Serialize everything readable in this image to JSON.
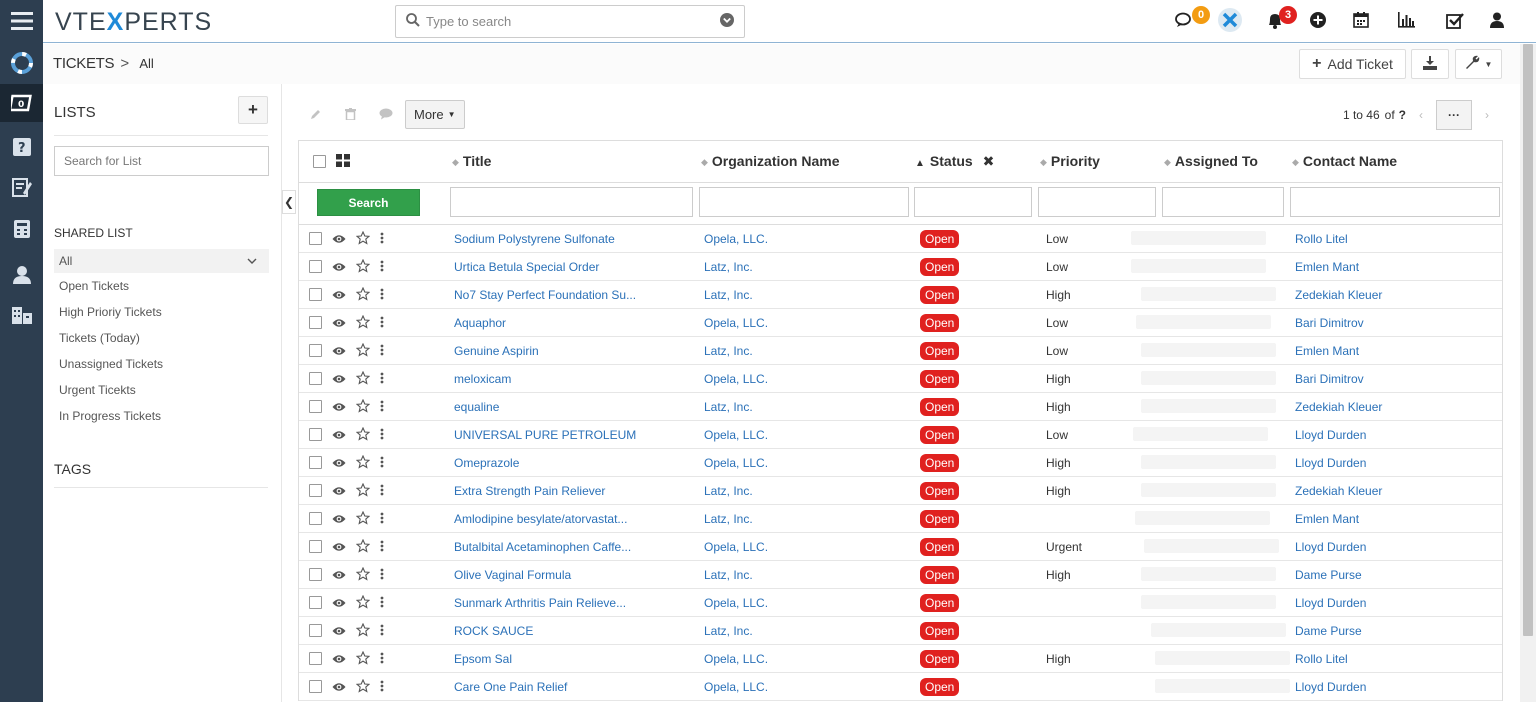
{
  "app": {
    "logo_pre": "VTE",
    "logo_x": "X",
    "logo_post": "PERTS"
  },
  "search": {
    "placeholder": "Type to search"
  },
  "notifications": {
    "chat_count": "0",
    "alert_count": "3"
  },
  "breadcrumb": {
    "module": "TICKETS",
    "separator": ">",
    "view": "All"
  },
  "header_buttons": {
    "add_ticket": "Add Ticket"
  },
  "lists": {
    "title": "LISTS",
    "add": "+",
    "search_placeholder": "Search for List",
    "shared_title": "SHARED LIST",
    "items": [
      {
        "label": "All"
      },
      {
        "label": "Open Tickets"
      },
      {
        "label": "High Prioriy Tickets"
      },
      {
        "label": "Tickets (Today)"
      },
      {
        "label": "Unassigned Tickets"
      },
      {
        "label": "Urgent Ticekts"
      },
      {
        "label": "In Progress Tickets"
      }
    ],
    "tags_title": "TAGS"
  },
  "toolbar": {
    "more_label": "More"
  },
  "pager": {
    "range": "1 to 46",
    "of_label": "of",
    "total": "?",
    "more": "···"
  },
  "columns": {
    "title": "Title",
    "organization": "Organization Name",
    "status": "Status",
    "priority": "Priority",
    "assigned": "Assigned To",
    "contact": "Contact Name"
  },
  "filter": {
    "search_label": "Search"
  },
  "rows": [
    {
      "title": "Sodium Polystyrene Sulfonate",
      "org": "Opela, LLC.",
      "status": "Open",
      "priority": "Low",
      "contact": "Rollo Litel"
    },
    {
      "title": "Urtica Betula Special Order",
      "org": "Latz, Inc.",
      "status": "Open",
      "priority": "Low",
      "contact": "Emlen Mant"
    },
    {
      "title": "No7 Stay Perfect Foundation Su...",
      "org": "Latz, Inc.",
      "status": "Open",
      "priority": "High",
      "contact": "Zedekiah Kleuer"
    },
    {
      "title": "Aquaphor",
      "org": "Opela, LLC.",
      "status": "Open",
      "priority": "Low",
      "contact": "Bari Dimitrov"
    },
    {
      "title": "Genuine Aspirin",
      "org": "Latz, Inc.",
      "status": "Open",
      "priority": "Low",
      "contact": "Emlen Mant"
    },
    {
      "title": "meloxicam",
      "org": "Opela, LLC.",
      "status": "Open",
      "priority": "High",
      "contact": "Bari Dimitrov"
    },
    {
      "title": "equaline",
      "org": "Latz, Inc.",
      "status": "Open",
      "priority": "High",
      "contact": "Zedekiah Kleuer"
    },
    {
      "title": "UNIVERSAL PURE PETROLEUM",
      "org": "Opela, LLC.",
      "status": "Open",
      "priority": "Low",
      "contact": "Lloyd Durden"
    },
    {
      "title": "Omeprazole",
      "org": "Opela, LLC.",
      "status": "Open",
      "priority": "High",
      "contact": "Lloyd Durden"
    },
    {
      "title": "Extra Strength Pain Reliever",
      "org": "Latz, Inc.",
      "status": "Open",
      "priority": "High",
      "contact": "Zedekiah Kleuer"
    },
    {
      "title": "Amlodipine besylate/atorvastat...",
      "org": "Latz, Inc.",
      "status": "Open",
      "priority": "",
      "contact": "Emlen Mant"
    },
    {
      "title": "Butalbital Acetaminophen Caffe...",
      "org": "Opela, LLC.",
      "status": "Open",
      "priority": "Urgent",
      "contact": "Lloyd Durden"
    },
    {
      "title": "Olive Vaginal Formula",
      "org": "Latz, Inc.",
      "status": "Open",
      "priority": "High",
      "contact": "Dame Purse"
    },
    {
      "title": "Sunmark Arthritis Pain Relieve...",
      "org": "Opela, LLC.",
      "status": "Open",
      "priority": "",
      "contact": "Lloyd Durden"
    },
    {
      "title": "ROCK SAUCE",
      "org": "Latz, Inc.",
      "status": "Open",
      "priority": "",
      "contact": "Dame Purse"
    },
    {
      "title": "Epsom Sal",
      "org": "Opela, LLC.",
      "status": "Open",
      "priority": "High",
      "contact": "Rollo Litel"
    },
    {
      "title": "Care One Pain Relief",
      "org": "Opela, LLC.",
      "status": "Open",
      "priority": "",
      "contact": "Lloyd Durden"
    }
  ]
}
